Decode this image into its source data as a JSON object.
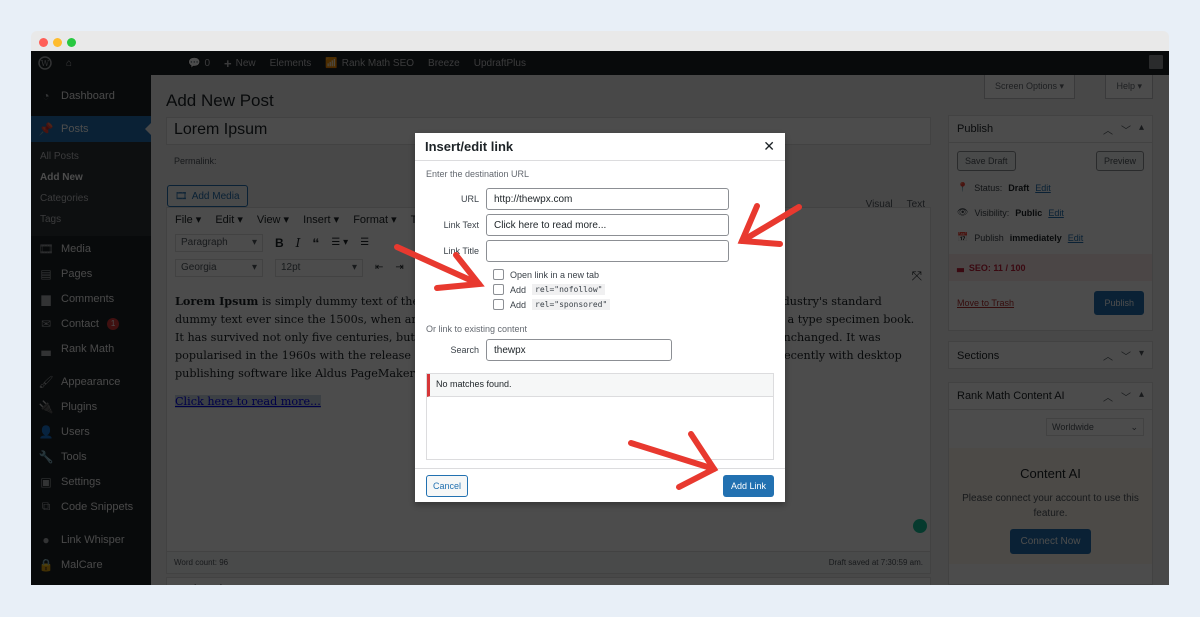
{
  "window": {
    "traffic_lights": [
      "#ff5f57",
      "#febc2e",
      "#28c840"
    ]
  },
  "adminbar": {
    "comments_count": "0",
    "new_label": "New",
    "items": [
      "Elements",
      "Rank Math SEO",
      "Breeze",
      "UpdraftPlus"
    ]
  },
  "sidebar": {
    "items": [
      {
        "label": "Dashboard",
        "icon": "dashboard-icon"
      },
      {
        "label": "Posts",
        "icon": "pin-icon",
        "active": true
      },
      {
        "label": "Media",
        "icon": "media-icon"
      },
      {
        "label": "Pages",
        "icon": "pages-icon"
      },
      {
        "label": "Comments",
        "icon": "comments-icon"
      },
      {
        "label": "Contact",
        "icon": "mail-icon",
        "badge": "1"
      },
      {
        "label": "Rank Math",
        "icon": "rank-math-icon"
      },
      {
        "label": "Appearance",
        "icon": "brush-icon"
      },
      {
        "label": "Plugins",
        "icon": "plugin-icon"
      },
      {
        "label": "Users",
        "icon": "user-icon"
      },
      {
        "label": "Tools",
        "icon": "wrench-icon"
      },
      {
        "label": "Settings",
        "icon": "settings-icon"
      },
      {
        "label": "Code Snippets",
        "icon": "code-icon"
      },
      {
        "label": "Link Whisper",
        "icon": "link-whisper-icon"
      },
      {
        "label": "MalCare",
        "icon": "lock-icon"
      }
    ],
    "submenu": [
      "All Posts",
      "Add New",
      "Categories",
      "Tags"
    ]
  },
  "main": {
    "page_title": "Add New Post",
    "screen_options": "Screen Options ▾",
    "help": "Help ▾",
    "post_title": "Lorem Ipsum",
    "permalink_label": "Permalink:",
    "add_media": "Add Media",
    "editor_tabs": [
      "Visual",
      "Text"
    ],
    "menubar": [
      "File ▾",
      "Edit ▾",
      "View ▾",
      "Insert ▾",
      "Format ▾",
      "Tools ▾"
    ],
    "format_select": "Paragraph",
    "font_select": "Georgia",
    "size_select": "12pt",
    "content_bold": "Lorem Ipsum",
    "content_text": " is simply dummy text of the printing and typesetting industry. Lorem Ipsum has been the industry's standard dummy text ever since the 1500s, when an unknown printer took a galley of type and scrambled it to make a type specimen book. It has survived not only five centuries, but also the leap into electronic typesetting, remaining essentially unchanged. It was popularised in the 1960s with the release of Letraset sheets containing Lorem Ipsum passages, and more recently with desktop publishing software like Aldus PageMaker including versions of Lorem Ipsum.",
    "content_link": "Click here to read more...",
    "word_count": "Word count: 96",
    "draft_saved": "Draft saved at 7:30:59 am.",
    "rank_math_box": "Rank Math SEO"
  },
  "publish": {
    "title": "Publish",
    "save_draft": "Save Draft",
    "preview": "Preview",
    "status_label": "Status:",
    "status_value": "Draft",
    "visibility_label": "Visibility:",
    "visibility_value": "Public",
    "publish_label": "Publish",
    "publish_value": "immediately",
    "edit": "Edit",
    "seo": "SEO: 11 / 100",
    "trash": "Move to Trash",
    "publish_btn": "Publish"
  },
  "sections_box": {
    "title": "Sections"
  },
  "content_ai": {
    "title": "Rank Math Content AI",
    "region": "Worldwide",
    "heading": "Content AI",
    "message": "Please connect your account to use this feature.",
    "connect": "Connect Now"
  },
  "modal": {
    "title": "Insert/edit link",
    "hint": "Enter the destination URL",
    "url_label": "URL",
    "url_value": "http://thewpx.com",
    "link_text_label": "Link Text",
    "link_text_value": "Click here to read more...",
    "link_title_label": "Link Title",
    "link_title_value": "",
    "open_new_tab": "Open link in a new tab",
    "add_label": "Add",
    "nofollow_code": "rel=\"nofollow\"",
    "sponsored_code": "rel=\"sponsored\"",
    "or_link": "Or link to existing content",
    "search_label": "Search",
    "search_value": "thewpx",
    "no_matches": "No matches found.",
    "cancel": "Cancel",
    "add_link": "Add Link"
  },
  "colors": {
    "accent": "#2271b1",
    "annotation_arrow": "#e8392f",
    "admin_dark": "#1d2327"
  }
}
